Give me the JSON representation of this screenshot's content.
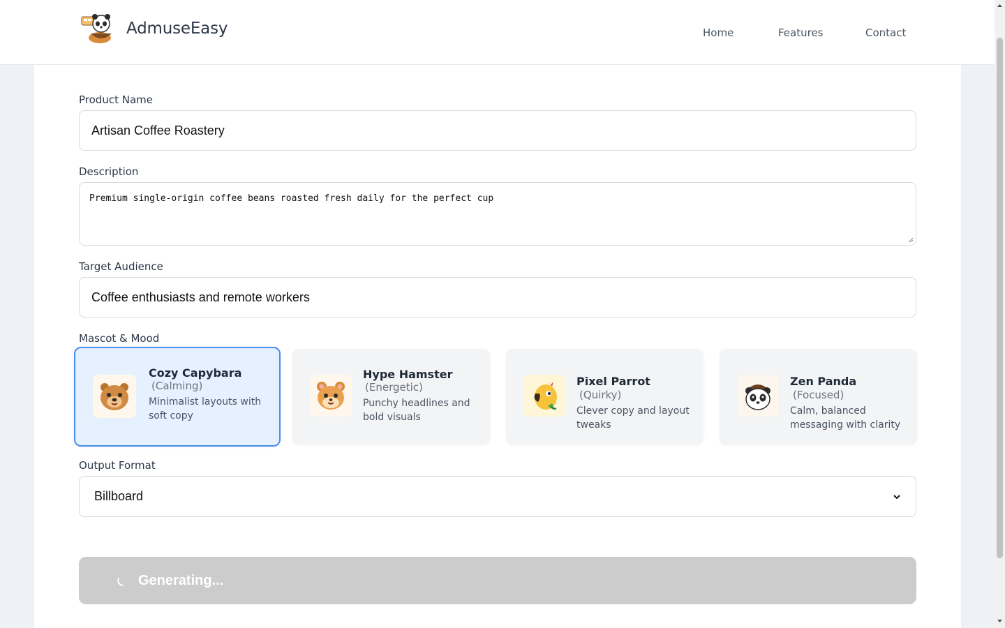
{
  "header": {
    "brand": "AdmuseEasy",
    "nav": [
      "Home",
      "Features",
      "Contact"
    ]
  },
  "form": {
    "product_name": {
      "label": "Product Name",
      "value": "Artisan Coffee Roastery"
    },
    "description": {
      "label": "Description",
      "value": "Premium single-origin coffee beans roasted fresh daily for the perfect cup"
    },
    "target_audience": {
      "label": "Target Audience",
      "value": "Coffee enthusiasts and remote workers"
    },
    "mascot": {
      "label": "Mascot & Mood",
      "selected": "Cozy Capybara",
      "options": [
        {
          "name": "Cozy Capybara",
          "mood": "(Calming)",
          "desc": "Minimalist layouts with soft copy",
          "icon": "capybara-icon"
        },
        {
          "name": "Hype Hamster",
          "mood": "(Energetic)",
          "desc": "Punchy headlines and bold visuals",
          "icon": "hamster-icon"
        },
        {
          "name": "Pixel Parrot",
          "mood": "(Quirky)",
          "desc": "Clever copy and layout tweaks",
          "icon": "parrot-icon"
        },
        {
          "name": "Zen Panda",
          "mood": "(Focused)",
          "desc": "Calm, balanced messaging with clarity",
          "icon": "panda-icon"
        }
      ]
    },
    "output_format": {
      "label": "Output Format",
      "value": "Billboard"
    },
    "submit": {
      "label": "Generating...",
      "state": "loading"
    }
  },
  "colors": {
    "selected_border": "#4a8cf0",
    "selected_bg": "#e6f1ff",
    "button_disabled": "#cccccc"
  }
}
